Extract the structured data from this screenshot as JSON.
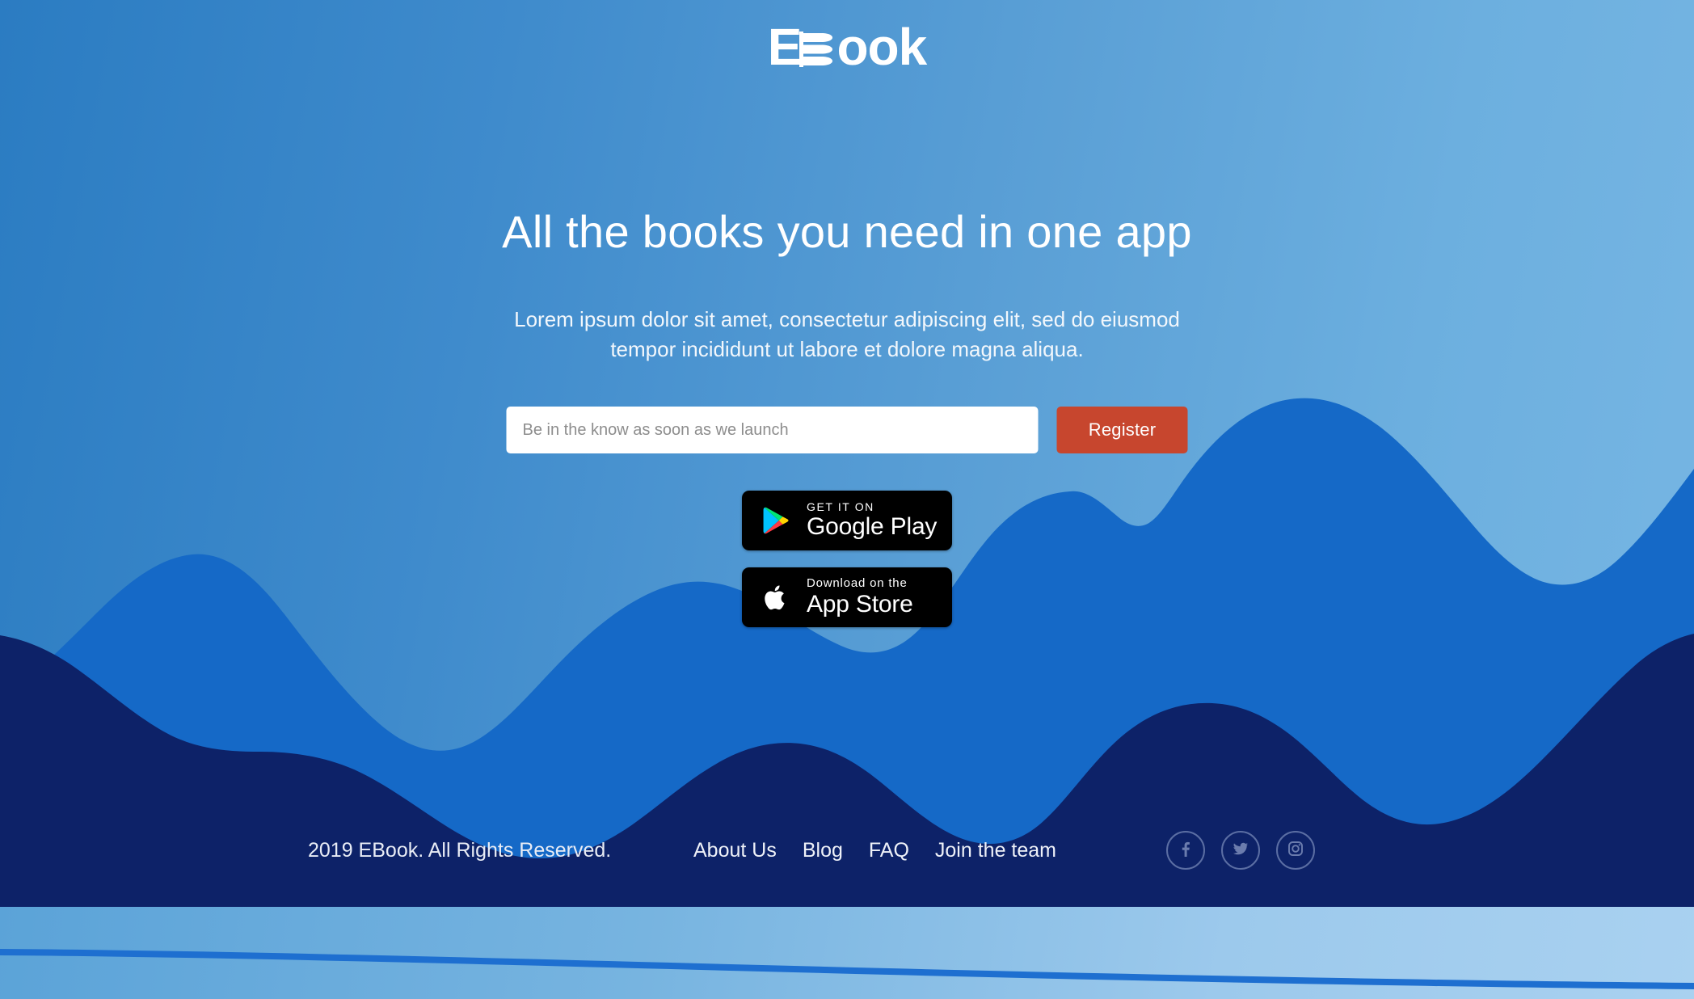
{
  "brand": {
    "logo_prefix": "E",
    "logo_mark": "book-pages-mark",
    "logo_suffix": "ook",
    "full_name": "EBook"
  },
  "hero": {
    "headline": "All the books you need in one app",
    "subhead": "Lorem ipsum dolor sit amet, consectetur adipiscing elit, sed do eiusmod tempor incididunt ut labore et dolore magna aliqua.",
    "signup": {
      "email_placeholder": "Be in the know as soon as we launch",
      "email_value": "",
      "register_label": "Register"
    },
    "badges": [
      {
        "id": "google-play",
        "small": "GET IT ON",
        "large": "Google Play",
        "icon": "google-play-icon"
      },
      {
        "id": "app-store",
        "small": "Download on the",
        "large": "App Store",
        "icon": "apple-icon"
      }
    ]
  },
  "footer": {
    "copyright": "2019 EBook. All Rights Reserved.",
    "links": [
      {
        "label": "About Us"
      },
      {
        "label": "Blog"
      },
      {
        "label": "FAQ"
      },
      {
        "label": "Join the team"
      }
    ],
    "socials": [
      {
        "name": "facebook",
        "icon": "facebook-icon"
      },
      {
        "name": "twitter",
        "icon": "twitter-icon"
      },
      {
        "name": "instagram",
        "icon": "instagram-icon"
      }
    ]
  },
  "colors": {
    "sky_dark": "#2b7cc2",
    "sky_light": "#77b6e3",
    "wave_mid": "#1569c7",
    "wave_dark": "#0d2268",
    "accent_register": "#c7462e",
    "footer_bg": "#0d2268",
    "social_outline": "#5b6ea3",
    "badge_bg": "#000000",
    "text_light": "#ffffff"
  }
}
